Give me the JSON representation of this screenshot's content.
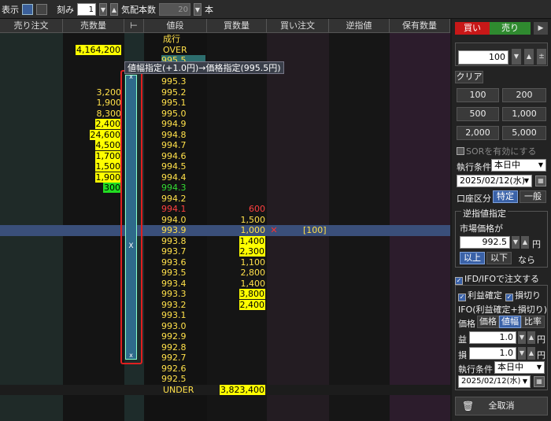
{
  "toolbar": {
    "display_label": "表示",
    "tick_label": "刻み",
    "tick_value": "1",
    "kehai_label": "気配本数",
    "kehai_value": "20",
    "hon_label": "本"
  },
  "headers": [
    "売り注文",
    "売数量",
    "値段",
    "買数量",
    "買い注文",
    "逆指値",
    "保有数量"
  ],
  "tooltip": "値幅指定(+1.0円)→価格指定(995.5円)",
  "rows": [
    {
      "price": "成行",
      "sell": "",
      "buy": ""
    },
    {
      "price": "OVER",
      "sell": "4,164,200",
      "buy": ""
    },
    {
      "price": "995.5",
      "sell": "",
      "buy": ""
    },
    {
      "price": "995.4",
      "sell": "",
      "buy": ""
    },
    {
      "price": "995.3",
      "sell": "",
      "buy": ""
    },
    {
      "price": "995.2",
      "sell": "3,200",
      "buy": ""
    },
    {
      "price": "995.1",
      "sell": "1,900",
      "buy": ""
    },
    {
      "price": "995.0",
      "sell": "8,300",
      "buy": ""
    },
    {
      "price": "994.9",
      "sell": "2,400",
      "buy": ""
    },
    {
      "price": "994.8",
      "sell": "24,600",
      "buy": ""
    },
    {
      "price": "994.7",
      "sell": "4,500",
      "buy": ""
    },
    {
      "price": "994.6",
      "sell": "1,700",
      "buy": ""
    },
    {
      "price": "994.5",
      "sell": "1,500",
      "buy": ""
    },
    {
      "price": "994.4",
      "sell": "1,900",
      "buy": ""
    },
    {
      "price": "994.3",
      "sell": "300",
      "buy": ""
    },
    {
      "price": "994.2",
      "sell": "",
      "buy": ""
    },
    {
      "price": "994.1",
      "sell": "",
      "buy": "600"
    },
    {
      "price": "994.0",
      "sell": "",
      "buy": "1,500"
    },
    {
      "price": "993.9",
      "sell": "",
      "buy": "1,000",
      "order": "[100]"
    },
    {
      "price": "993.8",
      "sell": "",
      "buy": "1,400"
    },
    {
      "price": "993.7",
      "sell": "",
      "buy": "2,300"
    },
    {
      "price": "993.6",
      "sell": "",
      "buy": "1,100"
    },
    {
      "price": "993.5",
      "sell": "",
      "buy": "2,800"
    },
    {
      "price": "993.4",
      "sell": "",
      "buy": "1,400"
    },
    {
      "price": "993.3",
      "sell": "",
      "buy": "3,800"
    },
    {
      "price": "993.2",
      "sell": "",
      "buy": "2,400"
    },
    {
      "price": "993.1",
      "sell": "",
      "buy": ""
    },
    {
      "price": "993.0",
      "sell": "",
      "buy": ""
    },
    {
      "price": "992.9",
      "sell": "",
      "buy": ""
    },
    {
      "price": "992.8",
      "sell": "",
      "buy": ""
    },
    {
      "price": "992.7",
      "sell": "",
      "buy": ""
    },
    {
      "price": "992.6",
      "sell": "",
      "buy": ""
    },
    {
      "price": "992.5",
      "sell": "",
      "buy": ""
    },
    {
      "price": "UNDER",
      "sell": "",
      "buy": "3,823,400"
    }
  ],
  "panel": {
    "buy_label": "買い",
    "sell_label": "売り",
    "qty": "100",
    "clear": "クリア",
    "qty_btns": [
      "100",
      "200",
      "500",
      "1,000",
      "2,000",
      "5,000"
    ],
    "sor": "SORを有効にする",
    "exec_label": "執行条件",
    "exec_value": "本日中",
    "date": "2025/02/12(水)",
    "account_label": "口座区分",
    "tokutei": "特定",
    "ippan": "一般",
    "stop_title": "逆指値指定",
    "market_price_label": "市場価格が",
    "stop_price": "992.5",
    "yen": "円",
    "ijou": "以上",
    "ika": "以下",
    "nara": "なら",
    "ifd": "IFD/IFOで注文する",
    "profit": "利益確定",
    "loss": "損切り",
    "ifo_desc": "IFO(利益確定+損切り)",
    "kakaku": "価格",
    "kakaku_btn": "価格",
    "nehaba_btn": "値幅",
    "hiritsu_btn": "比率",
    "eki": "益",
    "son": "損",
    "eki_val": "1.0",
    "son_val": "1.0",
    "exec_label2": "執行条件",
    "exec_value2": "本日中",
    "date2": "2025/02/12(水)",
    "cancel_all": "全取消"
  }
}
